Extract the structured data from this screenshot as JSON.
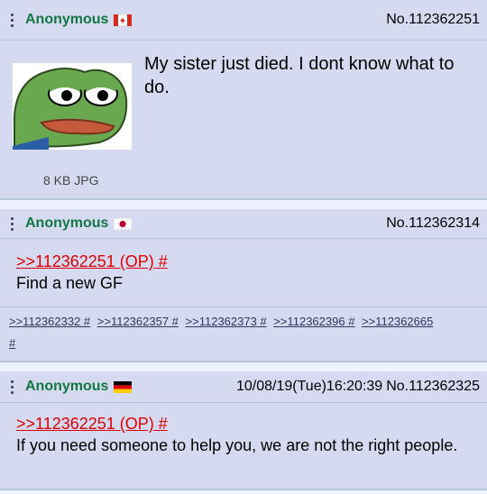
{
  "posts": [
    {
      "name": "Anonymous",
      "flag": "Canada",
      "number": "No.112362251",
      "file_info": "8 KB JPG",
      "image": "sad-frog",
      "text": "My sister just died. I dont know what to do."
    },
    {
      "name": "Anonymous",
      "flag": "Japan",
      "number": "No.112362314",
      "quote": ">>112362251 (OP) #",
      "text": "Find a new GF",
      "backlinks": [
        ">>112362332 #",
        ">>112362357 #",
        ">>112362373 #",
        ">>112362396 #",
        ">>112362665",
        "#"
      ]
    },
    {
      "name": "Anonymous",
      "flag": "Germany",
      "date": "10/08/19(Tue)16:20:39",
      "number": "No.112362325",
      "quote": ">>112362251 (OP) #",
      "text": "If you need someone to help you, we are not the right people."
    }
  ],
  "colors": {
    "post_bg": "#d6daf0",
    "name": "#117743",
    "quote_link": "#dd0000",
    "backlink": "#34345c"
  }
}
